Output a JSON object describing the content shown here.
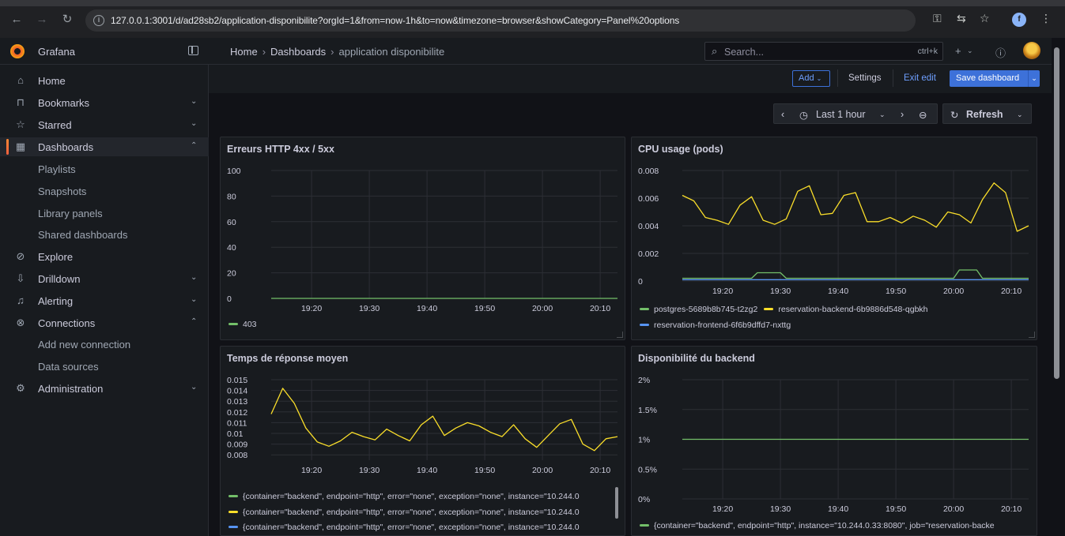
{
  "browser": {
    "url": "127.0.0.1:3001/d/ad28sb2/application-disponibilite?orgId=1&from=now-1h&to=now&timezone=browser&showCategory=Panel%20options",
    "profile_initial": "f"
  },
  "brand": "Grafana",
  "breadcrumb": {
    "home": "Home",
    "dashboards": "Dashboards",
    "current": "application disponibilite"
  },
  "search": {
    "placeholder": "Search...",
    "shortcut": "ctrl+k"
  },
  "sidebar": {
    "items": [
      {
        "label": "Home",
        "icon": "home-icon"
      },
      {
        "label": "Bookmarks",
        "icon": "bookmark-icon"
      },
      {
        "label": "Starred",
        "icon": "star-icon"
      },
      {
        "label": "Dashboards",
        "icon": "dashboards-icon"
      },
      {
        "label": "Playlists"
      },
      {
        "label": "Snapshots"
      },
      {
        "label": "Library panels"
      },
      {
        "label": "Shared dashboards"
      },
      {
        "label": "Explore",
        "icon": "compass-icon"
      },
      {
        "label": "Drilldown",
        "icon": "drilldown-icon"
      },
      {
        "label": "Alerting",
        "icon": "bell-icon"
      },
      {
        "label": "Connections",
        "icon": "connections-icon"
      },
      {
        "label": "Add new connection"
      },
      {
        "label": "Data sources"
      },
      {
        "label": "Administration",
        "icon": "gear-icon"
      }
    ]
  },
  "toolbar": {
    "add": "Add",
    "settings": "Settings",
    "exit_edit": "Exit edit",
    "save": "Save dashboard"
  },
  "time_picker": {
    "range": "Last 1 hour",
    "refresh": "Refresh"
  },
  "colors": {
    "green": "#73bf69",
    "yellow": "#fade2a",
    "blue": "#5794f2",
    "accent": "#3d71d9"
  },
  "panels": {
    "http_errors": {
      "title": "Erreurs HTTP 4xx / 5xx"
    },
    "cpu": {
      "title": "CPU usage (pods)"
    },
    "latency": {
      "title": "Temps de réponse moyen"
    },
    "availability": {
      "title": "Disponibilité du backend"
    }
  },
  "chart_data": [
    {
      "type": "line",
      "title": "Erreurs HTTP 4xx / 5xx",
      "ylim": [
        0,
        100
      ],
      "y_ticks": [
        "0",
        "20",
        "40",
        "60",
        "80",
        "100"
      ],
      "x_ticks": [
        "19:20",
        "19:30",
        "19:40",
        "19:50",
        "20:00",
        "20:10"
      ],
      "series": [
        {
          "name": "403",
          "color": "#73bf69",
          "x": [
            "19:13",
            "20:13"
          ],
          "values": [
            0,
            0
          ]
        }
      ]
    },
    {
      "type": "line",
      "title": "CPU usage (pods)",
      "ylim": [
        0,
        0.008
      ],
      "y_ticks": [
        "0",
        "0.002",
        "0.004",
        "0.006",
        "0.008"
      ],
      "x_ticks": [
        "19:20",
        "19:30",
        "19:40",
        "19:50",
        "20:00",
        "20:10"
      ],
      "series": [
        {
          "name": "postgres-5689b8b745-t2zg2",
          "color": "#73bf69",
          "x": [
            "19:13",
            "19:25",
            "19:26",
            "19:30",
            "19:31",
            "20:00",
            "20:01",
            "20:04",
            "20:05",
            "20:13"
          ],
          "values": [
            0.0002,
            0.0002,
            0.0006,
            0.0006,
            0.0002,
            0.0002,
            0.0008,
            0.0008,
            0.0002,
            0.0002
          ]
        },
        {
          "name": "reservation-backend-6b9886d548-qgbkh",
          "color": "#fade2a",
          "x": [
            "19:13",
            "19:15",
            "19:17",
            "19:19",
            "19:21",
            "19:23",
            "19:25",
            "19:27",
            "19:29",
            "19:31",
            "19:33",
            "19:35",
            "19:37",
            "19:39",
            "19:41",
            "19:43",
            "19:45",
            "19:47",
            "19:49",
            "19:51",
            "19:53",
            "19:55",
            "19:57",
            "19:59",
            "20:01",
            "20:03",
            "20:05",
            "20:07",
            "20:09",
            "20:11",
            "20:13"
          ],
          "values": [
            0.0062,
            0.0058,
            0.0046,
            0.0044,
            0.0041,
            0.0055,
            0.0061,
            0.0044,
            0.0041,
            0.0045,
            0.0065,
            0.0069,
            0.0048,
            0.0049,
            0.0062,
            0.0064,
            0.0043,
            0.0043,
            0.0046,
            0.0042,
            0.0047,
            0.0044,
            0.0039,
            0.005,
            0.0048,
            0.0042,
            0.0059,
            0.0071,
            0.0064,
            0.0036,
            0.004
          ]
        },
        {
          "name": "reservation-frontend-6f6b9dffd7-nxttg",
          "color": "#5794f2",
          "x": [
            "19:13",
            "20:13"
          ],
          "values": [
            0.0001,
            0.0001
          ]
        }
      ]
    },
    {
      "type": "line",
      "title": "Temps de réponse moyen",
      "ylim": [
        0.0075,
        0.015
      ],
      "y_ticks": [
        "0.008",
        "0.009",
        "0.01",
        "0.011",
        "0.012",
        "0.013",
        "0.014",
        "0.015"
      ],
      "x_ticks": [
        "19:20",
        "19:30",
        "19:40",
        "19:50",
        "20:00",
        "20:10"
      ],
      "series": [
        {
          "name": "{container=\"backend\", endpoint=\"http\", error=\"none\", exception=\"none\", instance=\"10.244.0",
          "color": "#73bf69",
          "x": [],
          "values": []
        },
        {
          "name": "{container=\"backend\", endpoint=\"http\", error=\"none\", exception=\"none\", instance=\"10.244.0",
          "color": "#fade2a",
          "x": [
            "19:13",
            "19:15",
            "19:17",
            "19:19",
            "19:21",
            "19:23",
            "19:25",
            "19:27",
            "19:29",
            "19:31",
            "19:33",
            "19:35",
            "19:37",
            "19:39",
            "19:41",
            "19:43",
            "19:45",
            "19:47",
            "19:49",
            "19:51",
            "19:53",
            "19:55",
            "19:57",
            "19:59",
            "20:01",
            "20:03",
            "20:05",
            "20:07",
            "20:09",
            "20:11",
            "20:13"
          ],
          "values": [
            0.0118,
            0.0142,
            0.0128,
            0.0105,
            0.0092,
            0.0088,
            0.0093,
            0.0101,
            0.0097,
            0.0094,
            0.0104,
            0.0098,
            0.0093,
            0.0108,
            0.0116,
            0.0098,
            0.0105,
            0.011,
            0.0107,
            0.0101,
            0.0097,
            0.0108,
            0.0095,
            0.0087,
            0.0098,
            0.0109,
            0.0113,
            0.009,
            0.0084,
            0.0095,
            0.0097
          ]
        },
        {
          "name": "{container=\"backend\", endpoint=\"http\", error=\"none\", exception=\"none\", instance=\"10.244.0",
          "color": "#5794f2",
          "x": [],
          "values": []
        }
      ]
    },
    {
      "type": "line",
      "title": "Disponibilité du backend",
      "ylim": [
        0,
        2
      ],
      "y_ticks": [
        "0%",
        "0.5%",
        "1%",
        "1.5%",
        "2%"
      ],
      "x_ticks": [
        "19:20",
        "19:30",
        "19:40",
        "19:50",
        "20:00",
        "20:10"
      ],
      "series": [
        {
          "name": "{container=\"backend\", endpoint=\"http\", instance=\"10.244.0.33:8080\", job=\"reservation-backe",
          "color": "#73bf69",
          "x": [
            "19:13",
            "20:13"
          ],
          "values": [
            1,
            1
          ]
        }
      ]
    }
  ]
}
